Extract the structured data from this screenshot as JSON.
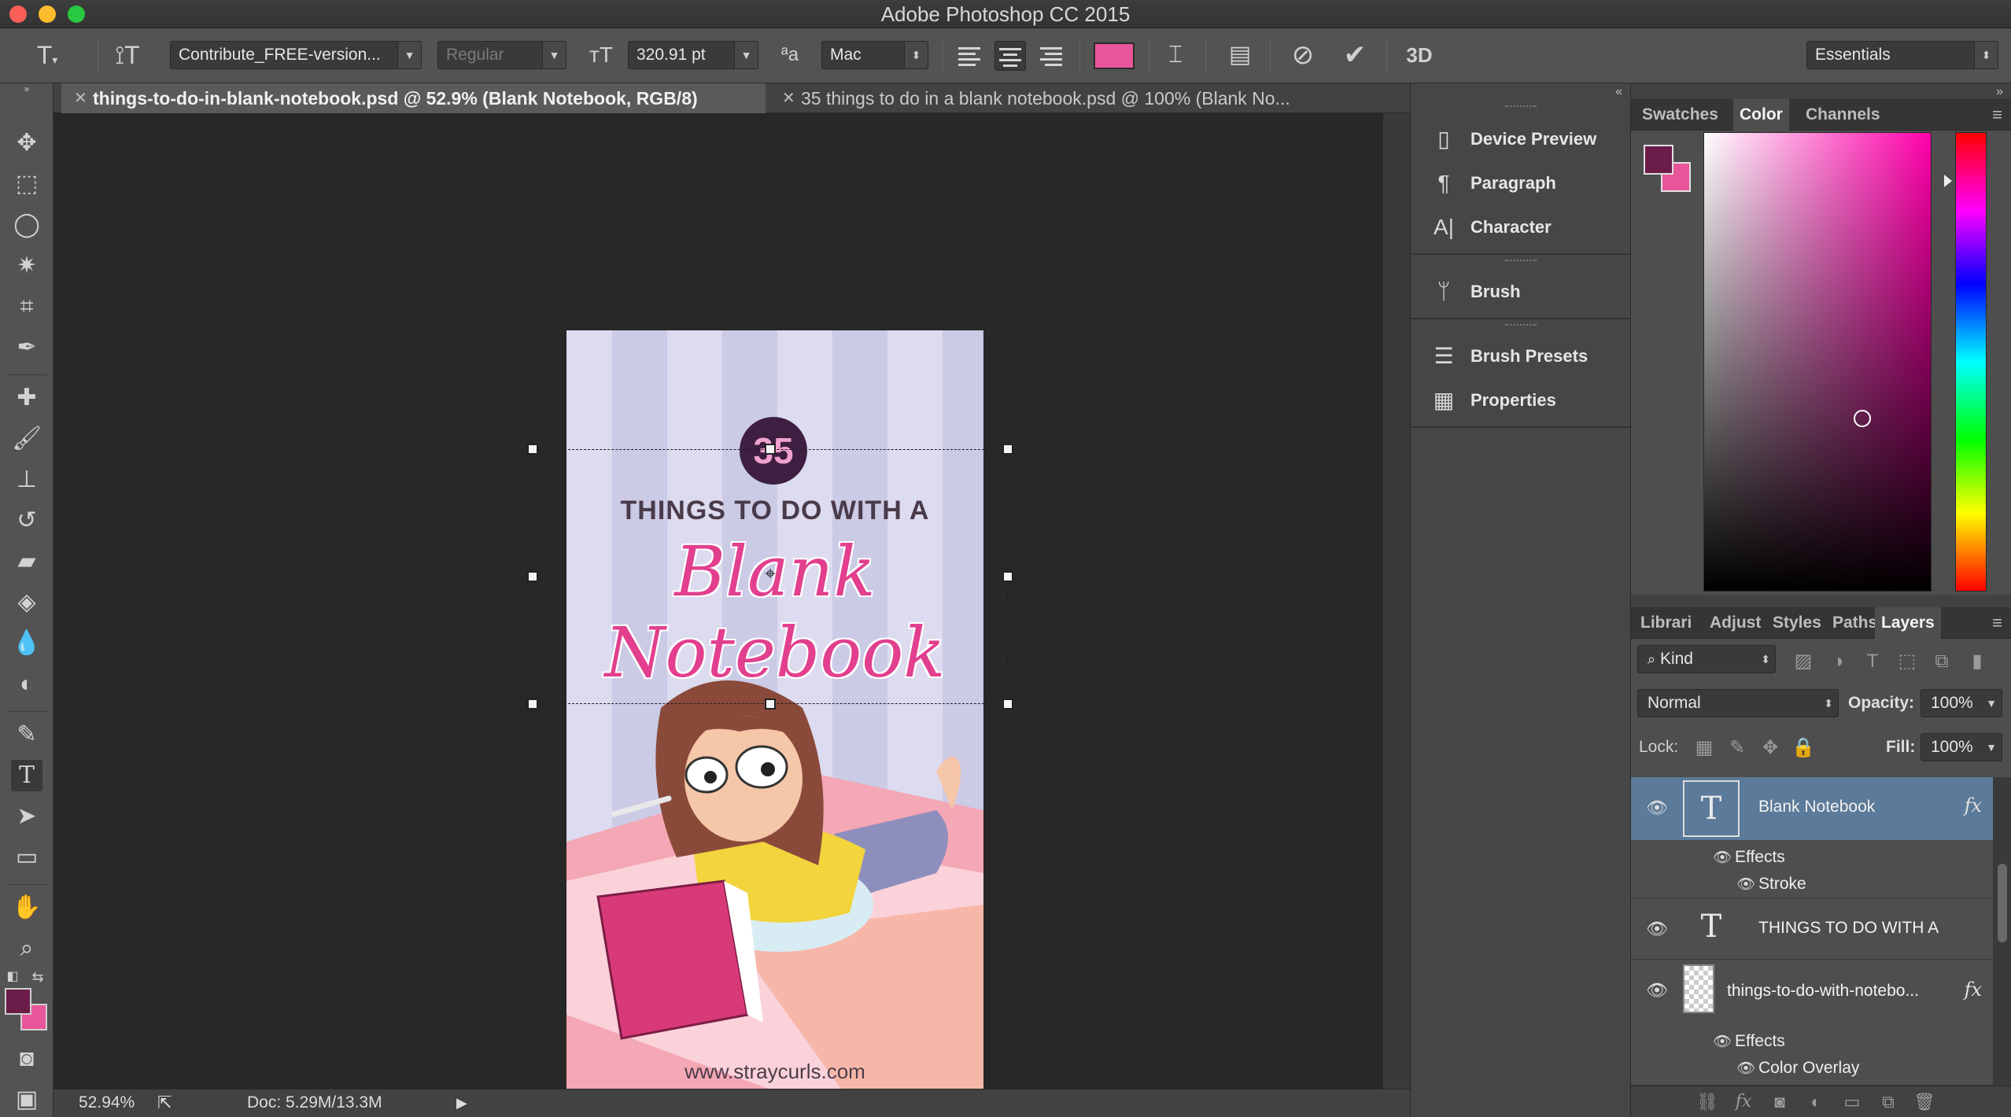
{
  "window": {
    "title": "Adobe Photoshop CC 2015"
  },
  "options_bar": {
    "font_family": "Contribute_FREE-version...",
    "font_style": "Regular",
    "font_size": "320.91 pt",
    "antialias": "Mac",
    "text_color": "#e9559a",
    "three_d": "3D",
    "workspace": "Essentials"
  },
  "tabs": [
    {
      "label": "things-to-do-in-blank-notebook.psd @ 52.9% (Blank Notebook, RGB/8)"
    },
    {
      "label": "35 things to do in a blank notebook.psd @ 100% (Blank No..."
    }
  ],
  "document": {
    "badge": "35",
    "subtitle": "THINGS TO DO WITH A",
    "title": "Blank Notebook",
    "url": "www.straycurls.com"
  },
  "status_bar": {
    "zoom": "52.94%",
    "doc_info": "Doc: 5.29M/13.3M"
  },
  "dock": {
    "items": [
      {
        "label": "Device Preview",
        "icon": "device-preview-icon"
      },
      {
        "label": "Paragraph",
        "icon": "paragraph-icon"
      },
      {
        "label": "Character",
        "icon": "character-icon"
      },
      {
        "label": "Brush",
        "icon": "brush-icon"
      },
      {
        "label": "Brush Presets",
        "icon": "brush-presets-icon"
      },
      {
        "label": "Properties",
        "icon": "properties-icon"
      }
    ]
  },
  "color_panel": {
    "tabs": [
      "Swatches",
      "Color",
      "Channels"
    ],
    "active_tab": "Color",
    "foreground": "#6b1c48",
    "background": "#e9559a"
  },
  "layers_panel": {
    "tabs": [
      "Librari",
      "Adjust",
      "Styles",
      "Paths",
      "Layers"
    ],
    "active_tab": "Layers",
    "filter_kind": "Kind",
    "blend_mode": "Normal",
    "opacity_label": "Opacity:",
    "opacity": "100%",
    "lock_label": "Lock:",
    "fill_label": "Fill:",
    "fill": "100%",
    "layers": [
      {
        "name": "Blank Notebook",
        "type": "text",
        "fx": "fx",
        "effects_label": "Effects",
        "effects": [
          "Stroke"
        ]
      },
      {
        "name": "THINGS TO DO WITH A",
        "type": "text"
      },
      {
        "name": "things-to-do-with-notebo...",
        "type": "smart",
        "fx": "fx",
        "effects_label": "Effects",
        "effects": [
          "Color Overlay"
        ]
      }
    ]
  }
}
